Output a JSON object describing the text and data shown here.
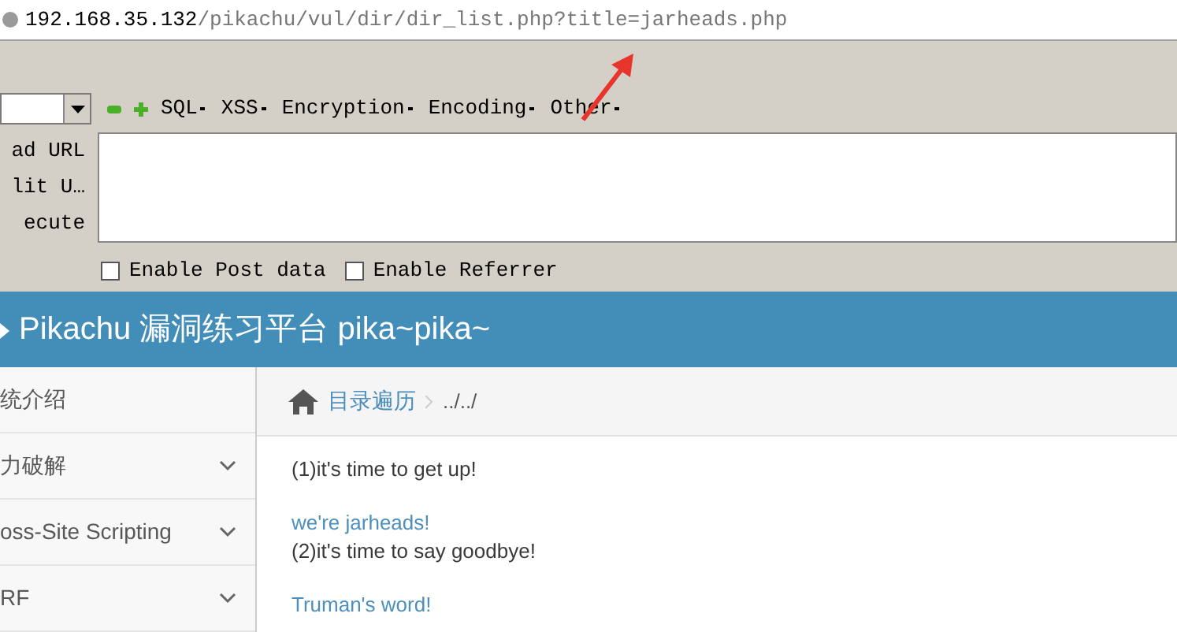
{
  "address_bar": {
    "host": "192.168.35.132",
    "path": "/pikachu/vul/dir/dir_list.php?title=jarheads.php"
  },
  "hackbar": {
    "menus": [
      "SQL",
      "XSS",
      "Encryption",
      "Encoding",
      "Other"
    ],
    "actions": [
      "ad URL",
      "lit U…",
      "ecute"
    ],
    "options": [
      {
        "label": "Enable Post data",
        "checked": false
      },
      {
        "label": "Enable Referrer",
        "checked": false
      }
    ]
  },
  "header": {
    "title": "Pikachu 漏洞练习平台 pika~pika~"
  },
  "sidebar": {
    "items": [
      {
        "label": "统介绍",
        "expandable": false
      },
      {
        "label": "力破解",
        "expandable": true
      },
      {
        "label": "oss-Site Scripting",
        "expandable": true
      },
      {
        "label": "RF",
        "expandable": true
      }
    ]
  },
  "breadcrumb": {
    "link": "目录遍历",
    "current": "../../"
  },
  "content": [
    {
      "kind": "text",
      "text": "(1)it's time to get up!"
    },
    {
      "kind": "link",
      "text": "we're jarheads!"
    },
    {
      "kind": "text",
      "text": "(2)it's time to say goodbye!"
    },
    {
      "kind": "link",
      "text": "Truman's word!"
    }
  ]
}
